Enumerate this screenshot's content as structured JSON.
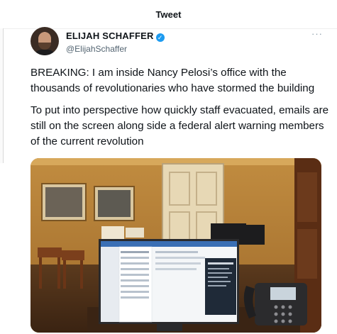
{
  "header": {
    "title": "Tweet"
  },
  "author": {
    "display_name": "ELIJAH SCHAFFER",
    "verified_glyph": "✓",
    "handle": "@ElijahSchaffer",
    "more_glyph": "···"
  },
  "tweet": {
    "paragraphs": [
      "BREAKING: I am inside Nancy Pelosi’s office with the thousands of revolutionaries who have stormed the building",
      "To put into perspective how quickly staff evacuated, emails are still on the screen along side a federal alert warning members of the current revolution"
    ]
  },
  "colors": {
    "verified": "#1d9bf0",
    "text": "#0f1419",
    "muted": "#536471"
  },
  "icons": [
    "verified-badge-icon",
    "more-options-icon"
  ]
}
